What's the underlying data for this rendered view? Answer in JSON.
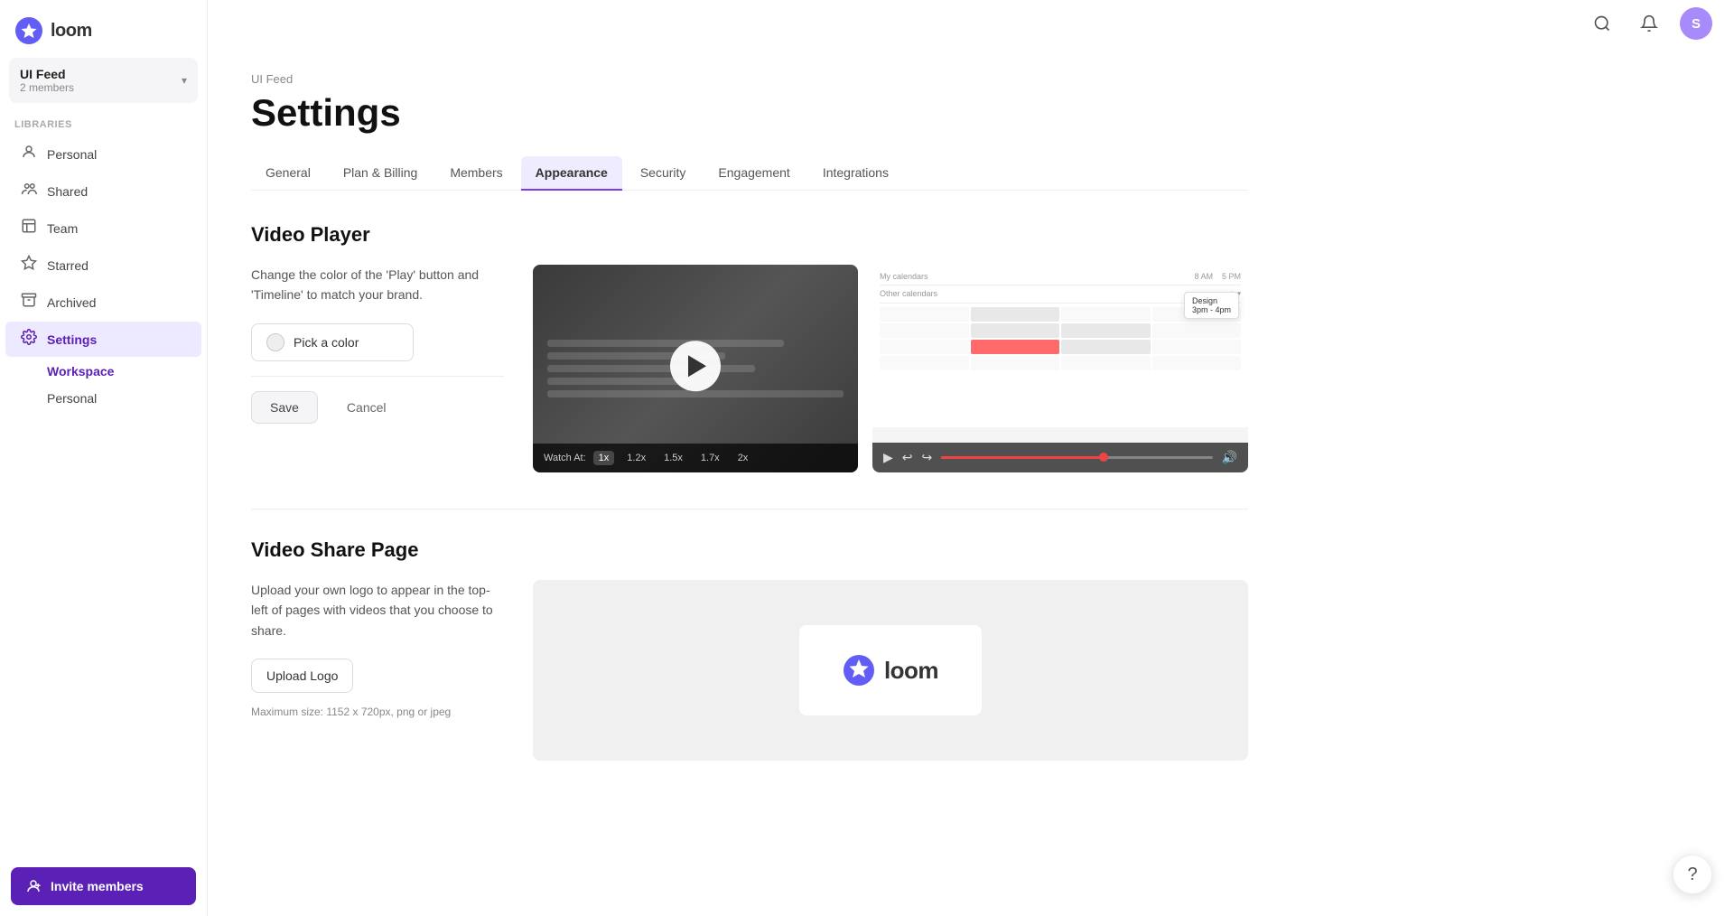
{
  "sidebar": {
    "logo_text": "loom",
    "workspace": {
      "name": "UI Feed",
      "members": "2 members"
    },
    "libraries_label": "Libraries",
    "items": [
      {
        "id": "personal",
        "label": "Personal",
        "icon": "👤"
      },
      {
        "id": "shared",
        "label": "Shared",
        "icon": "👥"
      },
      {
        "id": "team",
        "label": "Team",
        "icon": "🏠"
      },
      {
        "id": "starred",
        "label": "Starred",
        "icon": "⭐"
      },
      {
        "id": "archived",
        "label": "Archived",
        "icon": "📦"
      },
      {
        "id": "settings",
        "label": "Settings",
        "icon": "⚙️",
        "active": true
      }
    ],
    "settings_sub": [
      {
        "id": "workspace",
        "label": "Workspace",
        "active": true
      },
      {
        "id": "personal-sub",
        "label": "Personal"
      }
    ],
    "invite_btn": "Invite members"
  },
  "topbar": {
    "search_title": "Search",
    "bell_title": "Notifications",
    "avatar_letter": "S"
  },
  "main": {
    "breadcrumb": "UI Feed",
    "page_title": "Settings",
    "tabs": [
      {
        "id": "general",
        "label": "General"
      },
      {
        "id": "plan-billing",
        "label": "Plan & Billing"
      },
      {
        "id": "members",
        "label": "Members"
      },
      {
        "id": "appearance",
        "label": "Appearance",
        "active": true
      },
      {
        "id": "security",
        "label": "Security"
      },
      {
        "id": "engagement",
        "label": "Engagement"
      },
      {
        "id": "integrations",
        "label": "Integrations"
      }
    ],
    "video_player": {
      "title": "Video Player",
      "desc": "Change the color of the 'Play' button and 'Timeline' to match your brand.",
      "color_btn": "Pick a color",
      "save_btn": "Save",
      "cancel_btn": "Cancel",
      "watch_at": "Watch At:",
      "speeds": [
        "1x",
        "1.2x",
        "1.5x",
        "1.7x",
        "2x"
      ],
      "active_speed": "1x"
    },
    "video_share": {
      "title": "Video Share Page",
      "desc": "Upload your own logo to appear in the top-left of pages with videos that you choose to share.",
      "upload_btn": "Upload Logo",
      "max_size": "Maximum size: 1152 x 720px, png or jpeg"
    }
  }
}
